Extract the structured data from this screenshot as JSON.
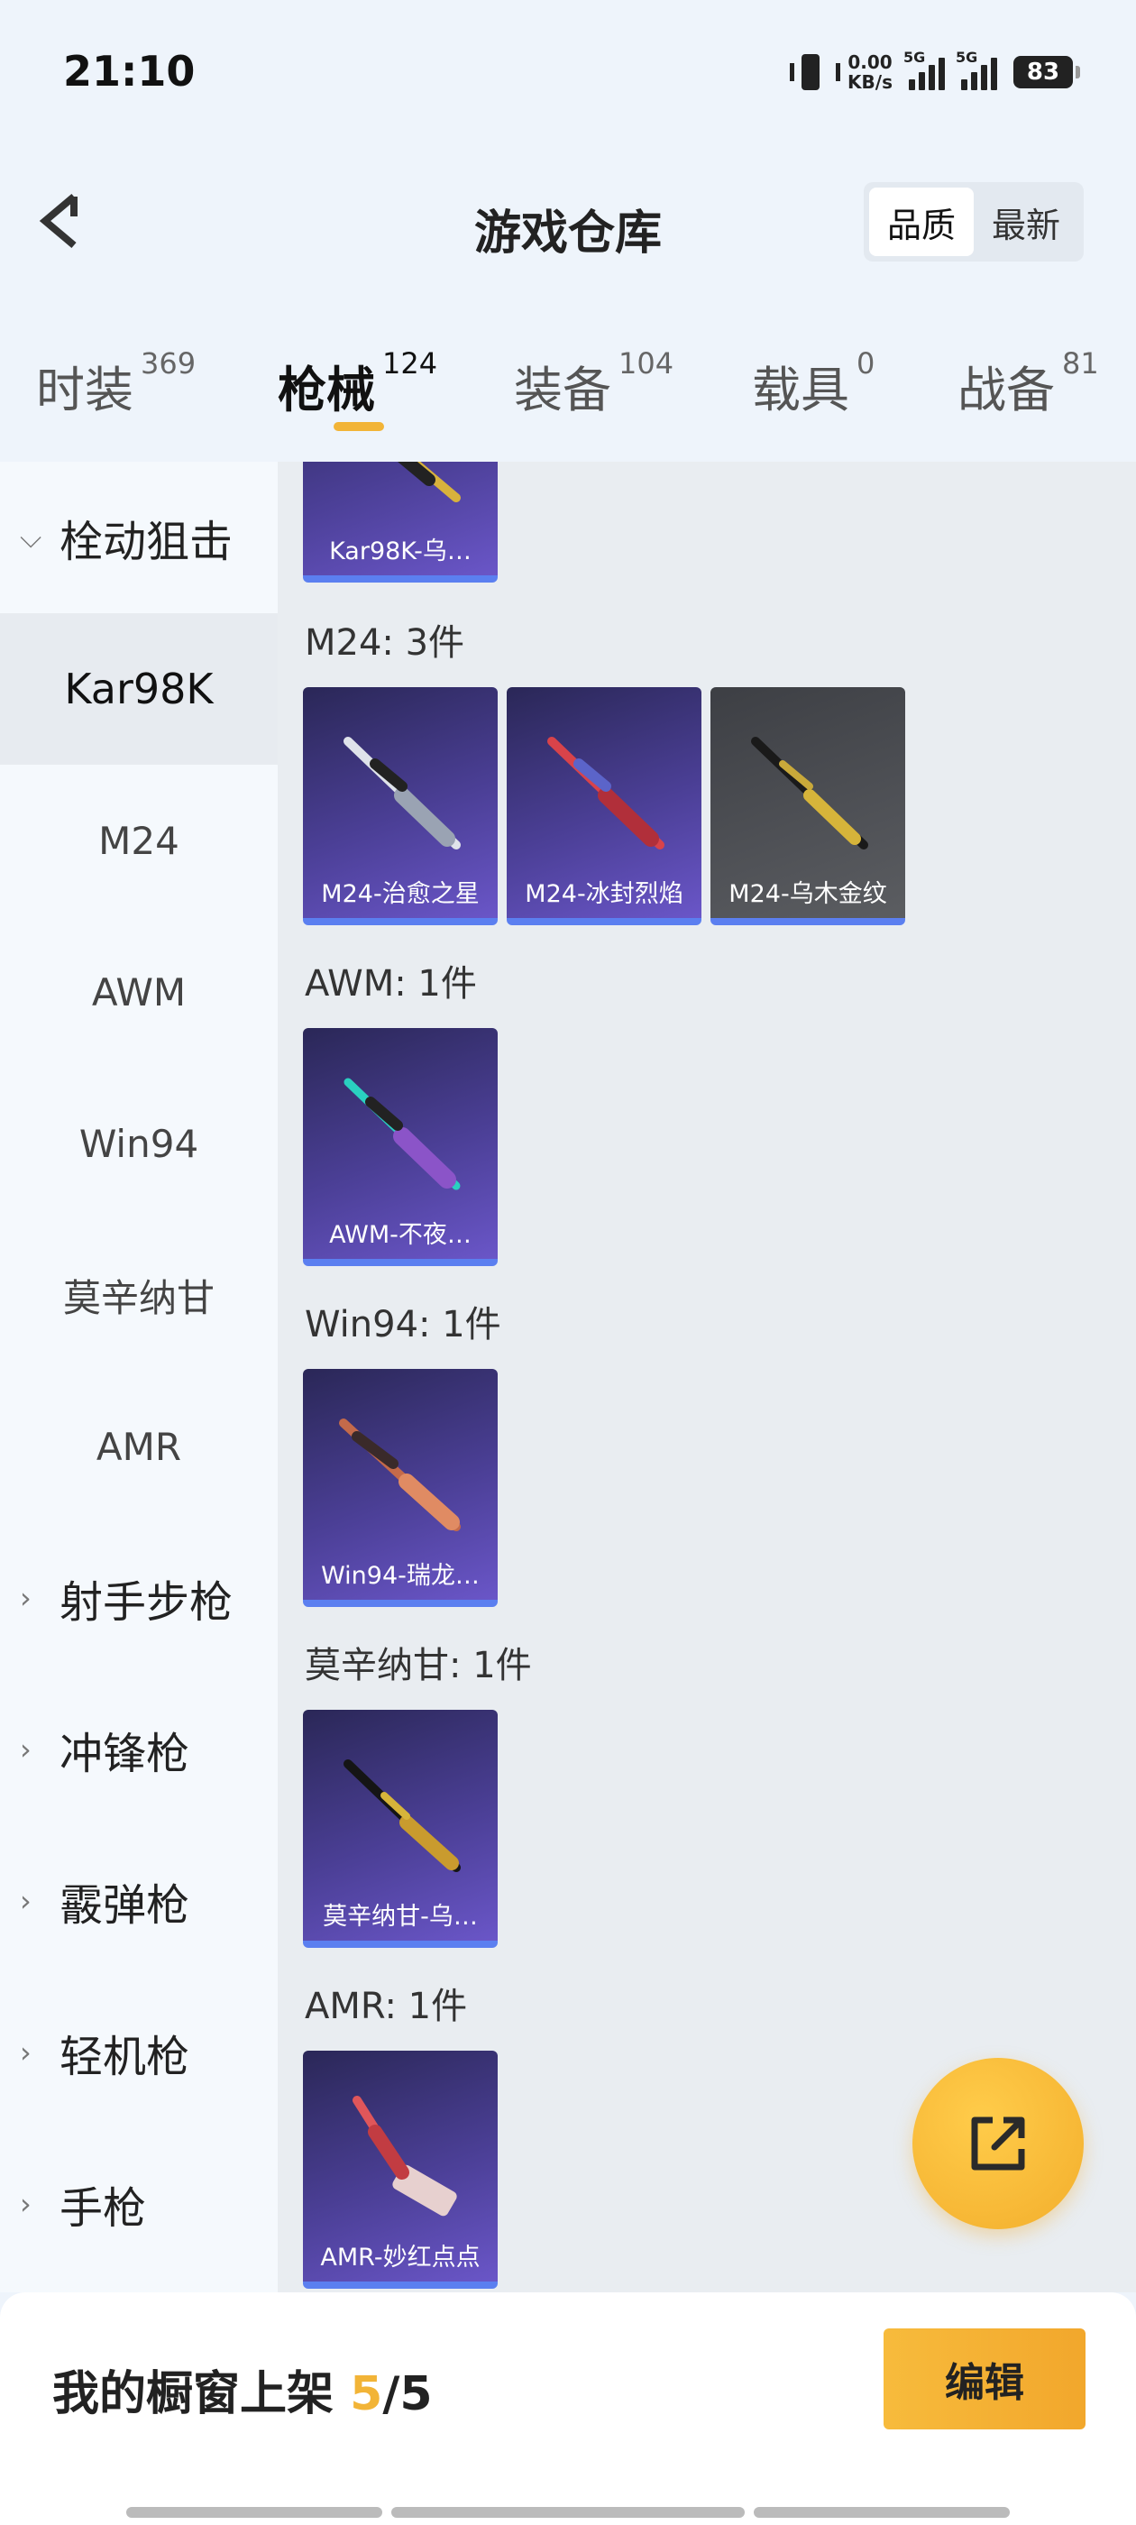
{
  "status": {
    "time": "21:10",
    "net_speed_value": "0.00",
    "net_speed_unit": "KB/s",
    "sim1": "5G",
    "sim2": "5G",
    "battery": "83"
  },
  "header": {
    "title": "游戏仓库",
    "sort_options": [
      "品质",
      "最新"
    ],
    "sort_selected": "品质"
  },
  "tabs": [
    {
      "label": "时装",
      "count": "369"
    },
    {
      "label": "枪械",
      "count": "124"
    },
    {
      "label": "装备",
      "count": "104"
    },
    {
      "label": "载具",
      "count": "0"
    },
    {
      "label": "战备",
      "count": "81"
    }
  ],
  "active_tab": "枪械",
  "sidebar": {
    "groups": [
      "栓动狙击",
      "射手步枪",
      "冲锋枪",
      "霰弹枪",
      "轻机枪",
      "手枪"
    ],
    "sub_items": [
      "Kar98K",
      "M24",
      "AWM",
      "Win94",
      "莫辛纳甘",
      "AMR"
    ],
    "active_item": "Kar98K"
  },
  "sections": [
    {
      "title": "",
      "items": [
        {
          "name": "Kar98K-乌…",
          "quality": "purple"
        }
      ]
    },
    {
      "title": "M24: 3件",
      "items": [
        {
          "name": "M24-治愈之星",
          "quality": "purple"
        },
        {
          "name": "M24-冰封烈焰",
          "quality": "purple"
        },
        {
          "name": "M24-乌木金纹",
          "quality": "grey"
        }
      ]
    },
    {
      "title": "AWM: 1件",
      "items": [
        {
          "name": "AWM-不夜…",
          "quality": "purple"
        }
      ]
    },
    {
      "title": "Win94: 1件",
      "items": [
        {
          "name": "Win94-瑞龙…",
          "quality": "purple"
        }
      ]
    },
    {
      "title": "莫辛纳甘: 1件",
      "items": [
        {
          "name": "莫辛纳甘-乌…",
          "quality": "purple"
        }
      ]
    },
    {
      "title": "AMR: 1件",
      "items": [
        {
          "name": "AMR-妙红点点",
          "quality": "purple"
        }
      ]
    }
  ],
  "bottom": {
    "showcase_label": "我的橱窗上架",
    "showcase_count": "5",
    "showcase_sep": "/",
    "showcase_total": "5",
    "edit_label": "编辑"
  },
  "colors": {
    "accent": "#f2b437",
    "card_purple": "#4b3f96",
    "card_grey": "#4f5156",
    "card_bar": "#5b7ff0"
  }
}
